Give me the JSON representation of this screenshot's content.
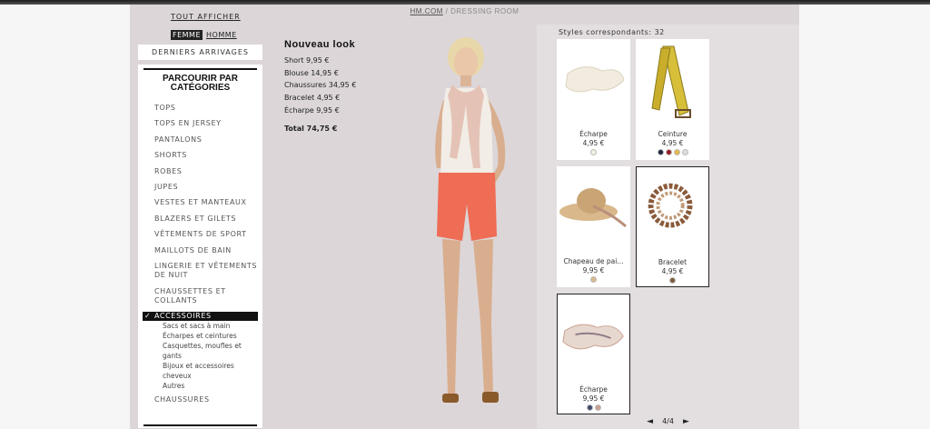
{
  "breadcrumb": {
    "home": "HM.COM",
    "separator": "/",
    "current": "DRESSING ROOM"
  },
  "nav": {
    "show_all": "TOUT AFFICHER",
    "gender_active": "FEMME",
    "gender_other": "HOMME",
    "new_arrivals": "DERNIERS ARRIVAGES",
    "browse_title_1": "PARCOURIR PAR",
    "browse_title_2": "CATÉGORIES",
    "categories": [
      "TOPS",
      "TOPS EN JERSEY",
      "PANTALONS",
      "SHORTS",
      "ROBES",
      "JUPES",
      "VESTES ET MANTEAUX",
      "BLAZERS ET GILETS",
      "VÊTEMENTS DE SPORT",
      "MAILLOTS DE BAIN",
      "LINGERIE ET VÊTEMENTS",
      "DE NUIT",
      "CHAUSSETTES ET",
      "COLLANTS"
    ],
    "selected_category": "ACCESSOIRES",
    "subcategories": [
      "Sacs et sacs à main",
      "Écharpes et ceintures",
      "Casquettes, moufles et",
      "gants",
      "Bijoux et accessoires",
      "cheveux",
      "Autres"
    ],
    "last_category": "CHAUSSURES"
  },
  "look": {
    "title": "Nouveau look",
    "items": [
      "Short  9,95 €",
      "Blouse  14,95 €",
      "Chaussures  34,95 €",
      "Bracelet  4,95 €",
      "Écharpe  9,95 €"
    ],
    "total": "Total 74,75 €"
  },
  "matches": {
    "title": "Styles correspondants: 32",
    "cards": [
      {
        "name": "Écharpe",
        "price": "4,95 €",
        "swatches": [
          "#f4efe4"
        ]
      },
      {
        "name": "Ceinture",
        "price": "4,95 €",
        "swatches": [
          "#1d2340",
          "#9a1c24",
          "#e3b94a",
          "#dddddd"
        ]
      },
      {
        "name": "Chapeau de pai...",
        "price": "9,95 €",
        "swatches": [
          "#d9b88c"
        ]
      },
      {
        "name": "Bracelet",
        "price": "4,95 €",
        "swatches": [
          "#7a5a3a"
        ]
      },
      {
        "name": "Écharpe",
        "price": "9,95 €",
        "swatches": [
          "#3f4a6e",
          "#c9a090"
        ]
      }
    ],
    "pager": {
      "prev": "◄",
      "label": "4/4",
      "next": "►"
    }
  },
  "colors": {
    "frame_bg": "#dcd6d8",
    "accent": "#111111"
  }
}
